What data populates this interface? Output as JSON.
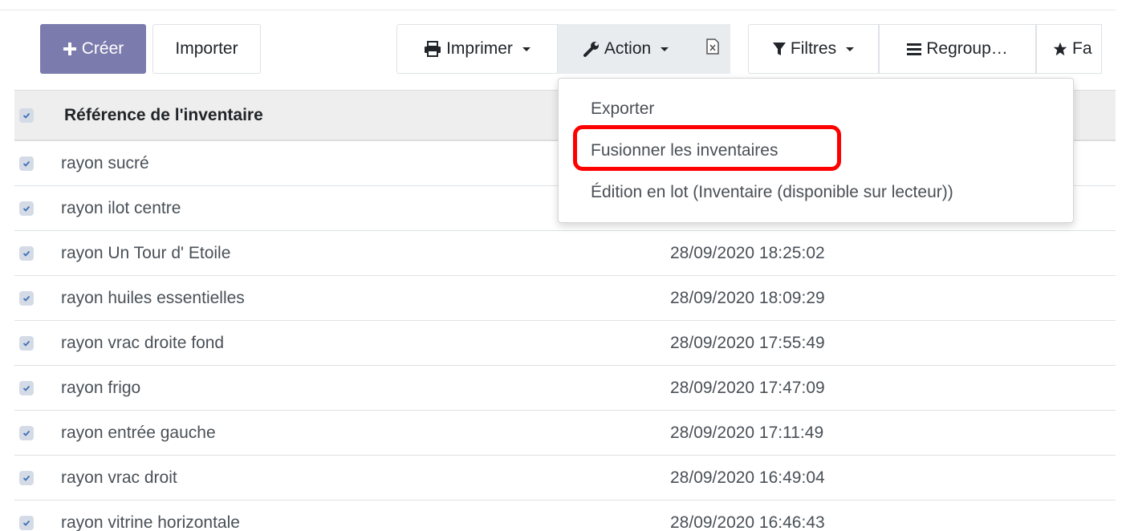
{
  "toolbar": {
    "create_label": "Créer",
    "import_label": "Importer",
    "print_label": "Imprimer",
    "action_label": "Action",
    "filters_label": "Filtres",
    "groupby_label": "Regroup…",
    "favorites_label": "Fa"
  },
  "icons": {
    "create": "plus-icon",
    "print": "printer-icon",
    "action": "wrench-icon",
    "export_xls": "spreadsheet-icon",
    "filters": "filter-icon",
    "groupby": "bars-icon",
    "favorites": "star-icon"
  },
  "colors": {
    "primary": "#7c7bad",
    "highlight": "#ff0000",
    "checkbox_bg": "#d5dbe6",
    "checkbox_check": "#3b6fb6"
  },
  "table": {
    "column_reference": "Référence de l'inventaire",
    "rows": [
      {
        "reference": "rayon sucré",
        "date": ""
      },
      {
        "reference": "rayon ilot centre",
        "date": ""
      },
      {
        "reference": "rayon Un Tour d' Etoile",
        "date": "28/09/2020 18:25:02"
      },
      {
        "reference": "rayon huiles essentielles",
        "date": "28/09/2020 18:09:29"
      },
      {
        "reference": "rayon vrac droite fond",
        "date": "28/09/2020 17:55:49"
      },
      {
        "reference": "rayon frigo",
        "date": "28/09/2020 17:47:09"
      },
      {
        "reference": "rayon entrée gauche",
        "date": "28/09/2020 17:11:49"
      },
      {
        "reference": "rayon vrac droit",
        "date": "28/09/2020 16:49:04"
      },
      {
        "reference": "rayon vitrine horizontale",
        "date": "28/09/2020 16:46:43"
      }
    ]
  },
  "action_menu": {
    "items": [
      {
        "label": "Exporter"
      },
      {
        "label": "Fusionner les inventaires"
      },
      {
        "label": "Édition en lot (Inventaire (disponible sur lecteur))"
      }
    ]
  }
}
